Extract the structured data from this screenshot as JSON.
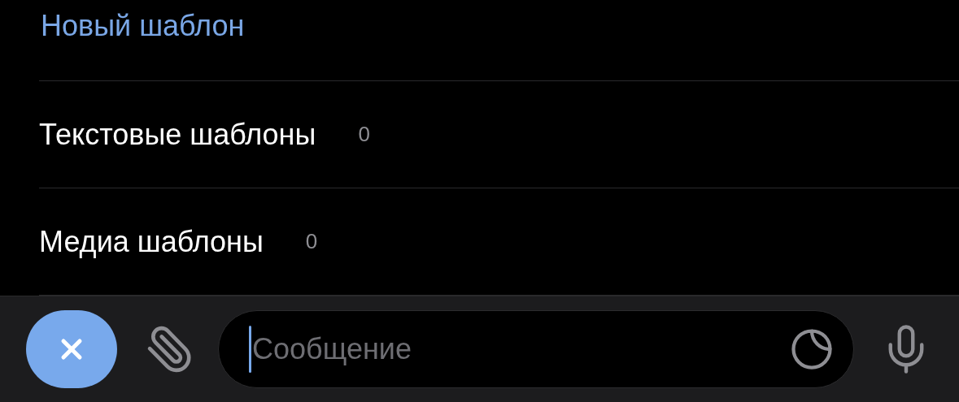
{
  "new_template_link": "Новый шаблон",
  "categories": [
    {
      "label": "Текстовые шаблоны",
      "count": "0"
    },
    {
      "label": "Медиа шаблоны",
      "count": "0"
    }
  ],
  "composer": {
    "placeholder": "Сообщение"
  }
}
